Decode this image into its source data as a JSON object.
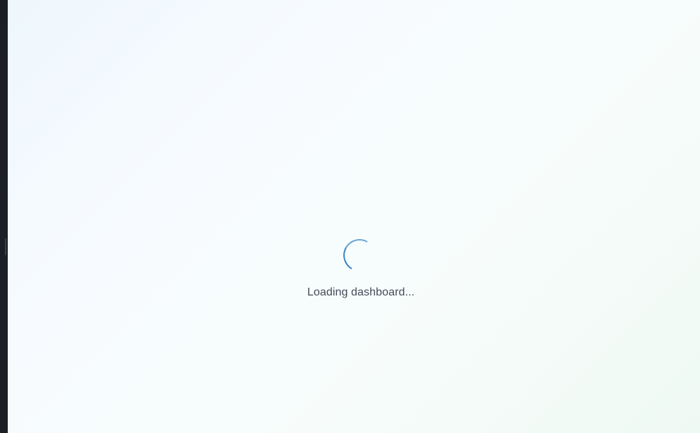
{
  "loader": {
    "message": "Loading dashboard...",
    "spinner_icon": "loading-spinner-icon"
  },
  "colors": {
    "spinner": "#3d87c4",
    "text": "#434c5a",
    "background_start": "#eef7fd",
    "background_end": "#eff9f3",
    "window_edge": "#1c1f26"
  }
}
